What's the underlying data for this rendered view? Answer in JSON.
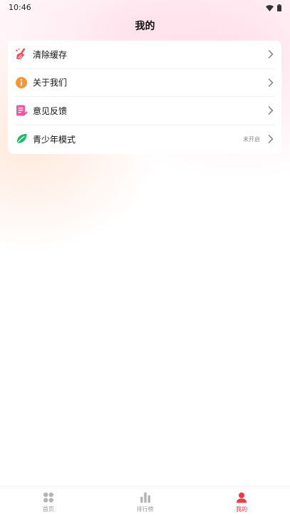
{
  "status_bar": {
    "time": "10:46",
    "icons": [
      "wifi-icon",
      "battery-icon"
    ]
  },
  "header": {
    "title": "我的"
  },
  "menu": {
    "items": [
      {
        "label": "清除缓存",
        "icon": "broom-icon",
        "value": ""
      },
      {
        "label": "关于我们",
        "icon": "info-icon",
        "value": ""
      },
      {
        "label": "意见反馈",
        "icon": "feedback-icon",
        "value": ""
      },
      {
        "label": "青少年模式",
        "icon": "leaf-icon",
        "value": "未开启"
      }
    ]
  },
  "tab_bar": {
    "tabs": [
      {
        "label": "首页",
        "icon": "home-grid-icon",
        "active": false
      },
      {
        "label": "排行榜",
        "icon": "ranking-icon",
        "active": false
      },
      {
        "label": "我的",
        "icon": "profile-icon",
        "active": true
      }
    ]
  },
  "colors": {
    "accent": "#ef3a44",
    "broom": "#ef4a55",
    "info": "#f5963b",
    "feedback": "#f0569f",
    "leaf": "#1fb86a",
    "inactive_tab": "#b5b5b5"
  }
}
